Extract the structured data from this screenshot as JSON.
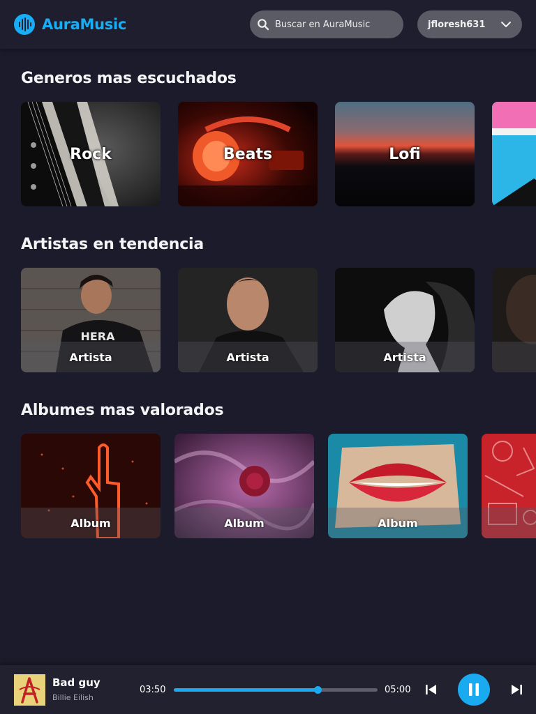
{
  "colors": {
    "accent": "#19aaf0",
    "background": "#1c1b2b",
    "pill": "#5b5b66"
  },
  "header": {
    "brand": "AuraMusic",
    "logo_icon": "waveform-icon",
    "search_placeholder": "Buscar en AuraMusic",
    "username": "jfloresh631"
  },
  "sections": {
    "genres": {
      "title": "Generos mas escuchados",
      "cards": [
        {
          "label": "Rock",
          "image": "electric-guitar-photo"
        },
        {
          "label": "Beats",
          "image": "red-headphones-photo"
        },
        {
          "label": "Lofi",
          "image": "sunset-horizon-photo"
        },
        {
          "label": "",
          "image": "pink-blue-wall-photo"
        }
      ]
    },
    "artists": {
      "title": "Artistas en tendencia",
      "cards": [
        {
          "label": "Artista",
          "image": "artist-hoodie-photo"
        },
        {
          "label": "Artista",
          "image": "artist-portrait-photo"
        },
        {
          "label": "Artista",
          "image": "artist-bw-woman-photo"
        },
        {
          "label": "",
          "image": "artist-dark-photo"
        }
      ]
    },
    "albums": {
      "title": "Albumes mas valorados",
      "cards": [
        {
          "label": "Album",
          "image": "neon-hand-photo"
        },
        {
          "label": "Album",
          "image": "rose-smoke-photo"
        },
        {
          "label": "Album",
          "image": "glitter-lips-photo"
        },
        {
          "label": "A",
          "image": "red-instruments-pattern"
        }
      ]
    }
  },
  "player": {
    "track_title": "Bad guy",
    "track_artist": "Billie Eilish",
    "elapsed": "03:50",
    "total": "05:00",
    "progress": 0.707,
    "state": "playing"
  }
}
